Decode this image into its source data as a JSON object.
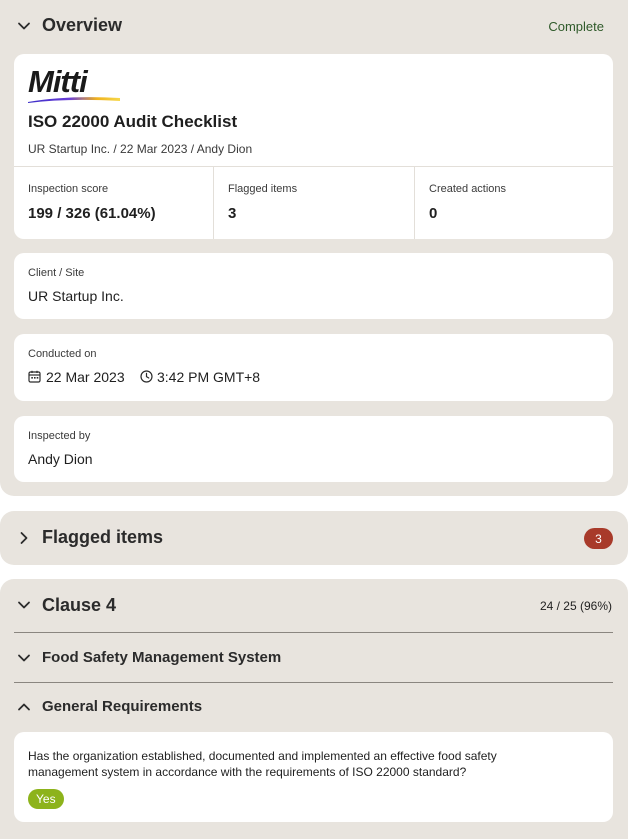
{
  "overview": {
    "title": "Overview",
    "status": "Complete",
    "logo_text": "Mitti",
    "report_title": "ISO 22000 Audit Checklist",
    "meta": "UR Startup Inc. / 22 Mar 2023 / Andy Dion",
    "stats": [
      {
        "label": "Inspection score",
        "value": "199 / 326 (61.04%)"
      },
      {
        "label": "Flagged items",
        "value": "3"
      },
      {
        "label": "Created actions",
        "value": "0"
      }
    ],
    "client_label": "Client / Site",
    "client_value": "UR Startup Inc.",
    "conducted_label": "Conducted on",
    "conducted_date": "22 Mar 2023",
    "conducted_time": "3:42 PM GMT+8",
    "inspected_label": "Inspected by",
    "inspected_value": "Andy Dion"
  },
  "flagged": {
    "title": "Flagged items",
    "count": "3"
  },
  "clause": {
    "title": "Clause 4",
    "score": "24 / 25 (96%)",
    "section": "Food Safety Management System",
    "subsection": "General Requirements",
    "question": "Has the organization established, documented and implemented an effective food safety management system in accordance with the requirements of ISO 22000 standard?",
    "answer": "Yes"
  },
  "colors": {
    "panel_bg": "#e8e4de",
    "status_green": "#2f5a2a",
    "badge_red": "#a83a2a",
    "answer_green": "#8db31b"
  }
}
